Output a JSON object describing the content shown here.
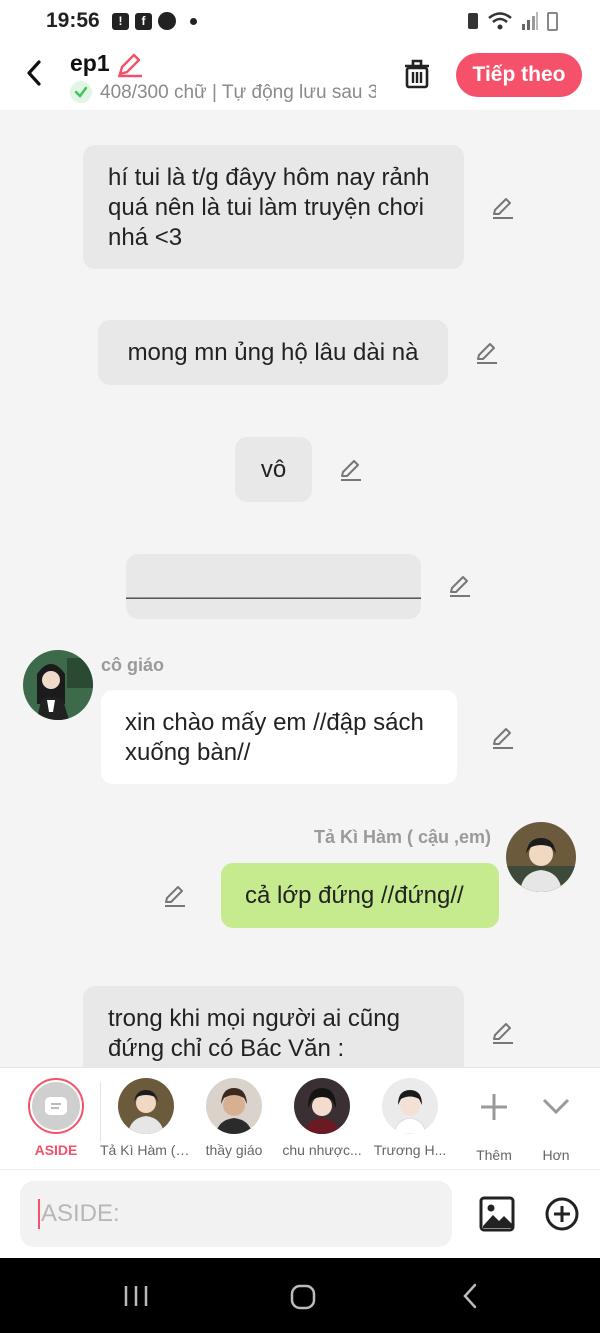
{
  "status": {
    "time": "19:56"
  },
  "header": {
    "title": "ep1",
    "word_count": "408/300 chữ | Tự động lưu sau 3",
    "next_label": "Tiếp theo"
  },
  "messages": [
    {
      "type": "aside",
      "text": "hí tui là t/g đâyy hôm nay rảnh quá nên là tui làm truyện chơi nhá <3"
    },
    {
      "type": "aside",
      "text": "mong mn ủng hộ lâu dài nà"
    },
    {
      "type": "aside",
      "text": "vô"
    },
    {
      "type": "aside",
      "text": "_______________________"
    },
    {
      "type": "left",
      "speaker": "cô giáo",
      "text": "xin chào mấy em //đập sách xuống bàn//"
    },
    {
      "type": "right",
      "speaker": "Tả Kì Hàm ( cậu ,em)",
      "text": "cả lớp đứng //đứng//"
    },
    {
      "type": "aside",
      "text": "trong khi mọi người ai cũng đứng chỉ có Bác Văn :"
    }
  ],
  "characters": [
    {
      "label": "ASIDE"
    },
    {
      "label": "Tả Kì Hàm ( cậu ,em)"
    },
    {
      "label": "thầy giáo"
    },
    {
      "label": "chu nhược..."
    },
    {
      "label": "Trương H..."
    }
  ],
  "char_actions": {
    "more": "Thêm",
    "expand": "Hơn"
  },
  "input": {
    "placeholder": "ASIDE:"
  },
  "colors": {
    "accent": "#f5516a",
    "bubble_green": "#c6eb8e",
    "bubble_aside": "#e8e8e8",
    "check_green": "#3cc35a"
  }
}
